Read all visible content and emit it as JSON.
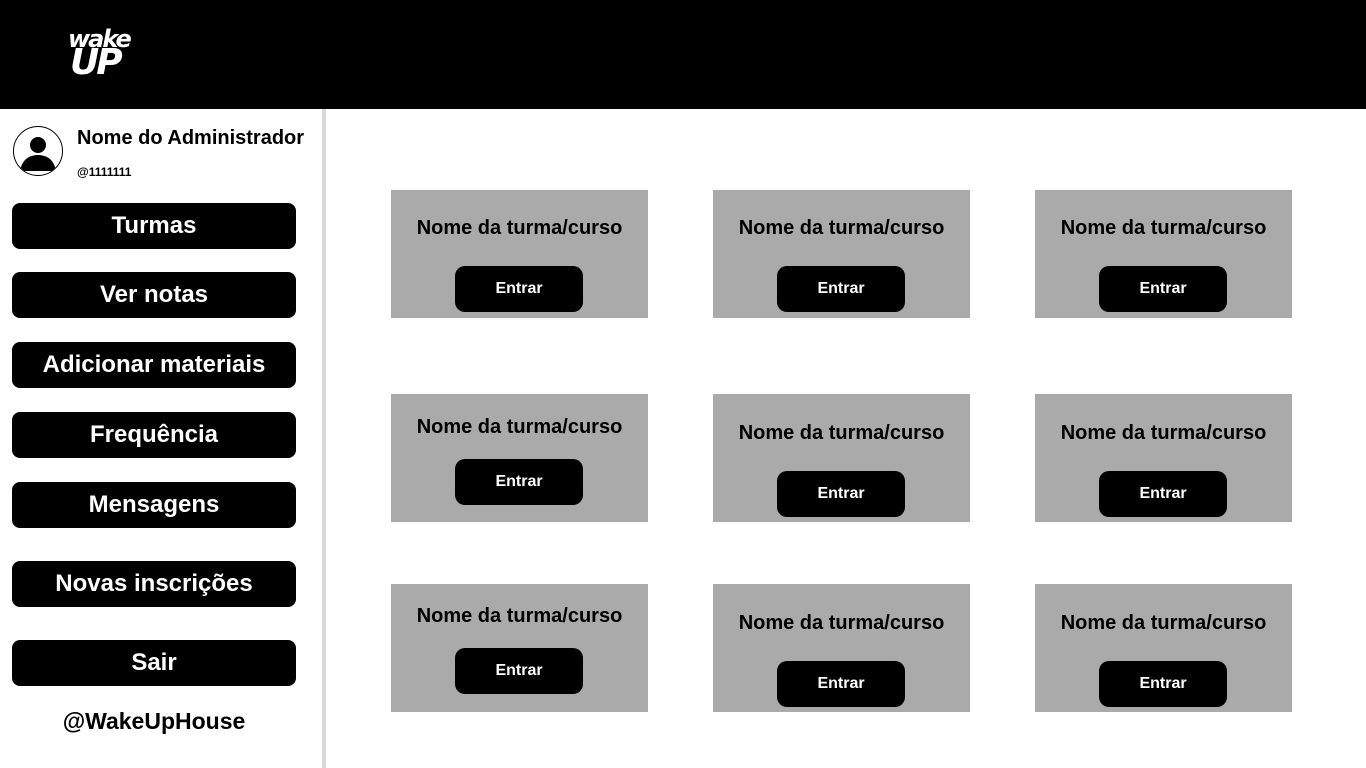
{
  "header": {
    "logo_top": "wake",
    "logo_bottom": "UP"
  },
  "profile": {
    "name": "Nome do Administrador",
    "handle": "@1111111"
  },
  "sidebar": {
    "items": [
      {
        "label": "Turmas"
      },
      {
        "label": "Ver notas"
      },
      {
        "label": "Adicionar materiais"
      },
      {
        "label": "Frequência"
      },
      {
        "label": "Mensagens"
      },
      {
        "label": "Novas inscrições"
      },
      {
        "label": "Sair"
      }
    ],
    "footer": "@WakeUpHouse"
  },
  "cards": [
    {
      "title": "Nome da turma/curso",
      "button": "Entrar"
    },
    {
      "title": "Nome da turma/curso",
      "button": "Entrar"
    },
    {
      "title": "Nome da turma/curso",
      "button": "Entrar"
    },
    {
      "title": "Nome da turma/curso",
      "button": "Entrar"
    },
    {
      "title": "Nome da turma/curso",
      "button": "Entrar"
    },
    {
      "title": "Nome da turma/curso",
      "button": "Entrar"
    },
    {
      "title": "Nome da turma/curso",
      "button": "Entrar"
    },
    {
      "title": "Nome da turma/curso",
      "button": "Entrar"
    },
    {
      "title": "Nome da turma/curso",
      "button": "Entrar"
    }
  ],
  "colors": {
    "header_bg": "#000000",
    "card_bg": "#aaaaaa",
    "button_bg": "#000000",
    "button_text": "#ffffff",
    "divider": "#d9d9d9"
  }
}
